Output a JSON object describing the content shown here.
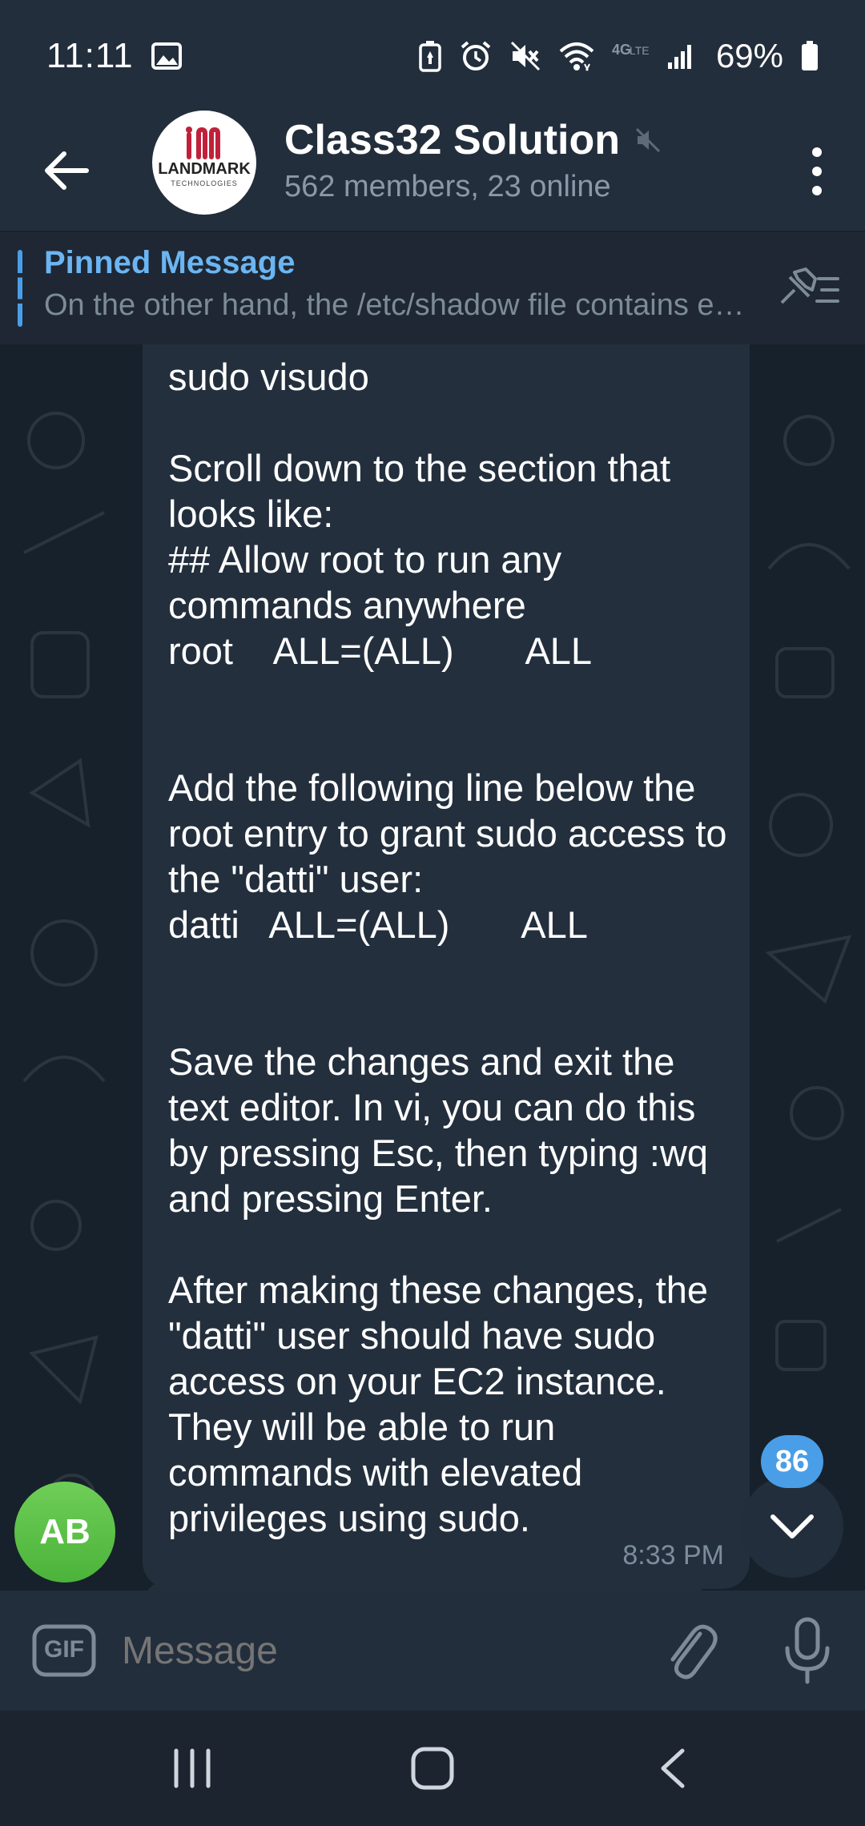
{
  "status_bar": {
    "time": "11:11",
    "battery_percent": "69%",
    "icons": [
      "image-icon",
      "battery-saver-icon",
      "alarm-icon",
      "mute-icon",
      "wifi-icon",
      "lte-icon",
      "signal-icon",
      "battery-icon"
    ]
  },
  "header": {
    "title": "Class32 Solution",
    "subtitle": "562 members, 23 online",
    "avatar_text": "LANDMARK",
    "avatar_subtext": "TECHNOLOGIES",
    "muted": true
  },
  "pinned": {
    "title": "Pinned Message",
    "text": "On the other hand, the /etc/shadow file contains encrypted passwords..."
  },
  "message": {
    "text": "sudo visudo\n\nScroll down to the section that looks like:\n## Allow root to run any commands anywhere\nroot    ALL=(ALL)       ALL\n\n\nAdd the following line below the root entry to grant sudo access to the \"datti\" user:\ndatti   ALL=(ALL)       ALL\n\n\nSave the changes and exit the text editor. In vi, you can do this by pressing Esc, then typing :wq and pressing Enter.\n\nAfter making these changes, the \"datti\" user should have sudo access on your EC2 instance. They will be able to run commands with elevated privileges using sudo.",
    "time": "8:33 PM",
    "sender_initials": "AB"
  },
  "scroll": {
    "unread_count": "86"
  },
  "composer": {
    "placeholder": "Message",
    "gif_label": "GIF"
  },
  "colors": {
    "accent": "#4a9ee8",
    "bubble": "#232f3d",
    "background": "#17212b",
    "avatar_green": "#5cc04a"
  }
}
